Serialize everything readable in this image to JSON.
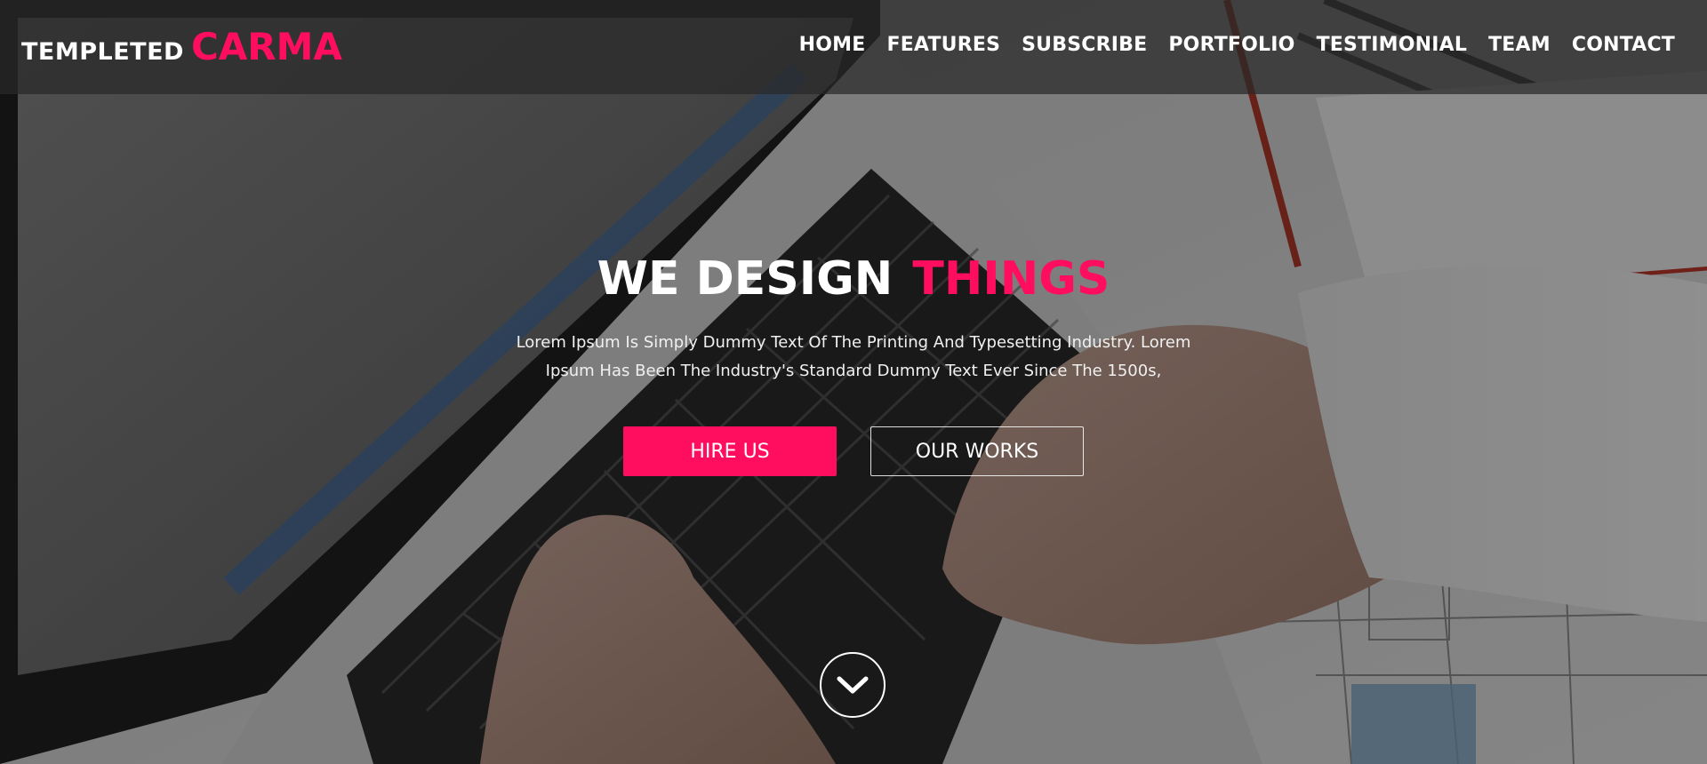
{
  "colors": {
    "accent": "#ff0d5f",
    "topbar": "#282828",
    "text": "#ffffff"
  },
  "header": {
    "brand_prefix": "TEMPLETED",
    "brand_name": "CARMA",
    "nav": [
      "HOME",
      "FEATURES",
      "SUBSCRIBE",
      "PORTFOLIO",
      "TESTIMONIAL",
      "TEAM",
      "CONTACT"
    ]
  },
  "hero": {
    "headline_main": "WE DESIGN",
    "headline_accent": "THINGS",
    "description": "Lorem Ipsum Is Simply Dummy Text Of The Printing And Typesetting Industry. Lorem Ipsum Has Been The Industry's Standard Dummy Text Ever Since The 1500s,",
    "primary_button": "HIRE US",
    "secondary_button": "OUR WORKS",
    "scroll_icon": "chevron-down-icon"
  }
}
